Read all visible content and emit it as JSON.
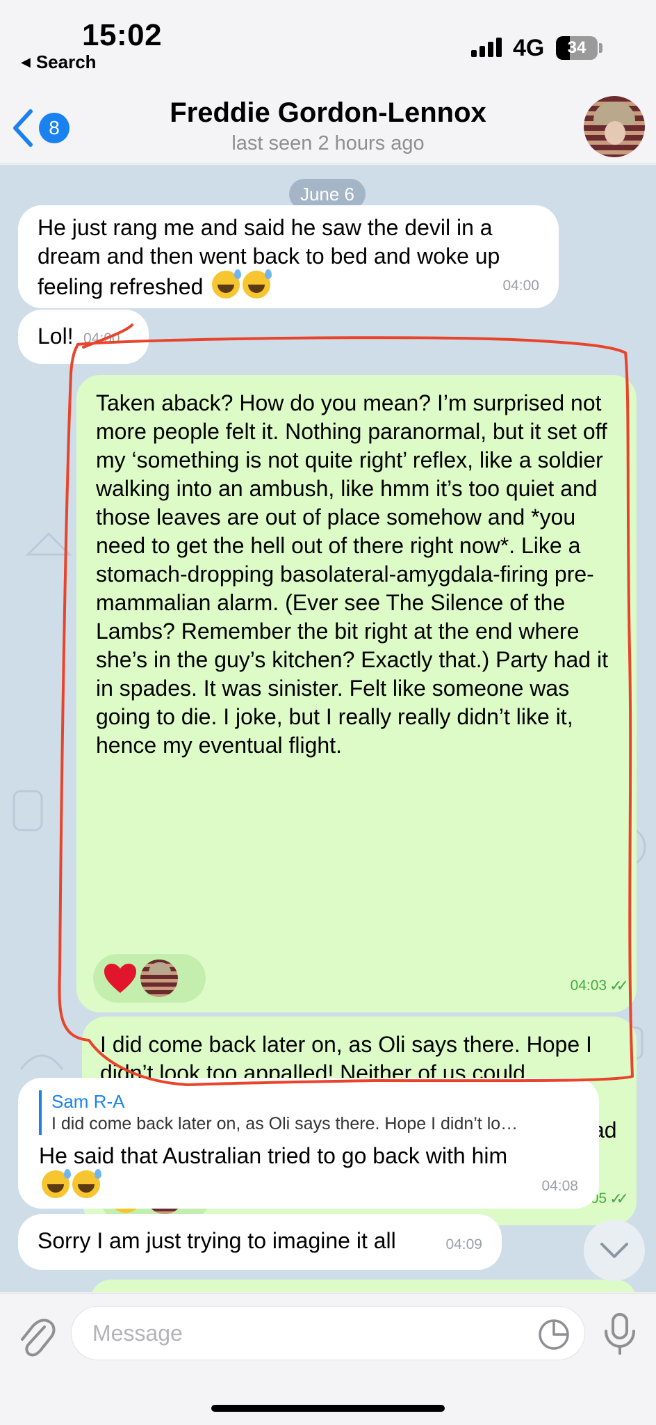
{
  "status_bar": {
    "time": "15:02",
    "back_label": "Search",
    "network": "4G",
    "battery": "34"
  },
  "header": {
    "unread_count": "8",
    "contact_name": "Freddie Gordon-Lennox",
    "last_seen": "last seen 2 hours ago"
  },
  "chat": {
    "date_pill": "June 6",
    "messages": [
      {
        "direction": "in",
        "text": "He just rang me and said he saw the devil in a dream and then went back to bed and woke up feeling refreshed",
        "emojis": [
          "grinning-face-with-sweat",
          "grinning-face-with-sweat"
        ],
        "time": "04:00"
      },
      {
        "direction": "in",
        "text": "Lol!",
        "time": "04:00"
      },
      {
        "direction": "out",
        "text": "Taken aback? How do you mean? I’m surprised not more people felt it. Nothing paranormal, but it set off my ‘something is not quite right’ reflex, like a soldier walking into an ambush, like hmm it’s too quiet and those leaves are out of place somehow and *you need to get the hell out of there right now*. Like a stomach-dropping basolateral-amygdala-firing pre-mammalian alarm. (Ever see The Silence of the Lambs? Remember the bit right at the end where she’s in the guy’s kitchen? Exactly that.) Party had it in spades. It was sinister. Felt like someone was going to die. I joke, but I really really didn’t like it, hence my eventual flight.",
        "reactions": [
          "heart-icon",
          "avatar"
        ],
        "time": "04:03"
      },
      {
        "direction": "out",
        "text": "I did come back later on, as Oli says there. Hope I didn’t look too appalled! Neither of us could remember when exactly he left, but that Alex guy stayed far longer. If it were much longer I’d have had to call pest control.",
        "reactions": [
          "woozy-face-icon",
          "avatar"
        ],
        "time": "04:05"
      },
      {
        "direction": "in",
        "reply_to": {
          "name": "Sam R-A",
          "text": "I did come back later on, as Oli says there. Hope I didn’t lo…"
        },
        "text": "He said that Australian tried to go back with him",
        "emojis": [
          "grinning-face-with-sweat",
          "grinning-face-with-sweat"
        ],
        "time": "04:08"
      },
      {
        "direction": "in",
        "text": "Sorry I am just trying to imagine it all",
        "time": "04:09"
      }
    ]
  },
  "input": {
    "placeholder": "Message"
  },
  "colors": {
    "accent": "#1a82f0",
    "outgoing_bubble": "#ddfbc7",
    "incoming_bubble": "#ffffff",
    "chat_background": "#cfdde9",
    "annotation_red": "#e8442c"
  }
}
